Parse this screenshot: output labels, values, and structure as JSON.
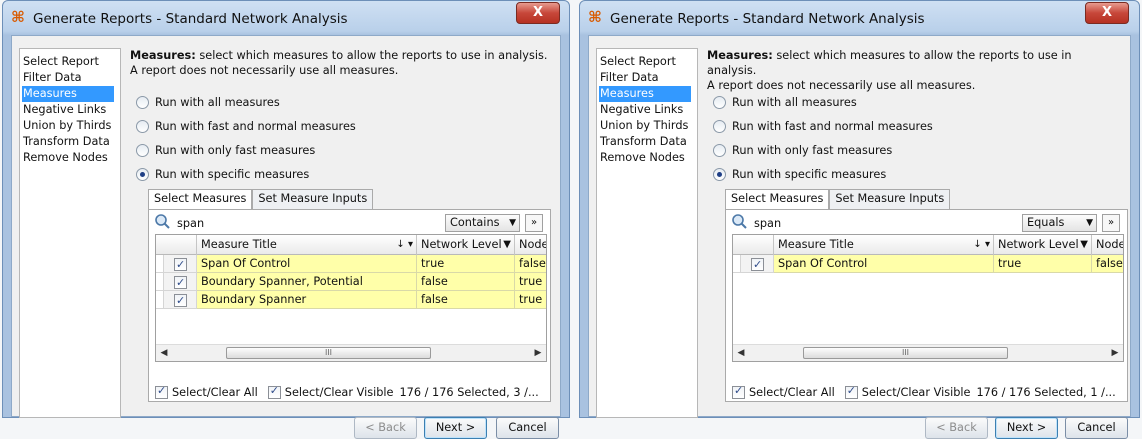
{
  "windows": [
    {
      "title": "Generate Reports - Standard Network Analysis",
      "close_glyph": "X",
      "nav_items": [
        "Select Report",
        "Filter Data",
        "Measures",
        "Negative Links",
        "Union by Thirds",
        "Transform Data",
        "Remove Nodes"
      ],
      "selected_nav": "Measures",
      "description_bold": "Measures:",
      "description_rest": " select which measures to allow the reports to use in analysis.",
      "description_line2": "A report does not necessarily use all measures.",
      "radio_options": [
        "Run with all measures",
        "Run with fast and normal measures",
        "Run with only fast measures",
        "Run with specific measures"
      ],
      "selected_radio": "Run with specific measures",
      "tabs": [
        "Select Measures",
        "Set Measure Inputs"
      ],
      "active_tab": "Select Measures",
      "search_value": "span",
      "match_mode": "Contains",
      "expand_glyph": "»",
      "columns": [
        "Measure Title",
        "Network Level",
        "Node"
      ],
      "sort_glyph": "↓ ▾",
      "rows": [
        {
          "checked": true,
          "title": "Span Of Control",
          "network_level": "true",
          "node": "false"
        },
        {
          "checked": true,
          "title": "Boundary Spanner, Potential",
          "network_level": "false",
          "node": "true"
        },
        {
          "checked": true,
          "title": "Boundary Spanner",
          "network_level": "false",
          "node": "true"
        }
      ],
      "scroll_thumb_glyph": "III",
      "select_clear_all": "Select/Clear All",
      "select_clear_visible": "Select/Clear Visible",
      "selection_status": "176 / 176 Selected, 3 /...",
      "buttons": {
        "back": "< Back",
        "next": "Next >",
        "cancel": "Cancel"
      },
      "colors": {
        "selection": "#3399ff",
        "highlight_row": "#ffffa9",
        "close_button": "#c7473a"
      }
    },
    {
      "title": "Generate Reports - Standard Network Analysis",
      "close_glyph": "X",
      "nav_items": [
        "Select Report",
        "Filter Data",
        "Measures",
        "Negative Links",
        "Union by Thirds",
        "Transform Data",
        "Remove Nodes"
      ],
      "selected_nav": "Measures",
      "description_bold": "Measures:",
      "description_rest": " select which measures to allow the reports to use in analysis.",
      "description_line2": "A report does not necessarily use all measures.",
      "radio_options": [
        "Run with all measures",
        "Run with fast and normal measures",
        "Run with only fast measures",
        "Run with specific measures"
      ],
      "selected_radio": "Run with specific measures",
      "tabs": [
        "Select Measures",
        "Set Measure Inputs"
      ],
      "active_tab": "Select Measures",
      "search_value": "span",
      "match_mode": "Equals",
      "expand_glyph": "»",
      "columns": [
        "Measure Title",
        "Network Level",
        "Node"
      ],
      "sort_glyph": "↓ ▾",
      "rows": [
        {
          "checked": true,
          "title": "Span Of Control",
          "network_level": "true",
          "node": "false"
        }
      ],
      "scroll_thumb_glyph": "III",
      "select_clear_all": "Select/Clear All",
      "select_clear_visible": "Select/Clear Visible",
      "selection_status": "176 / 176 Selected, 1 /...",
      "buttons": {
        "back": "< Back",
        "next": "Next >",
        "cancel": "Cancel"
      },
      "colors": {
        "selection": "#3399ff",
        "highlight_row": "#ffffa9",
        "close_button": "#c7473a"
      }
    }
  ]
}
